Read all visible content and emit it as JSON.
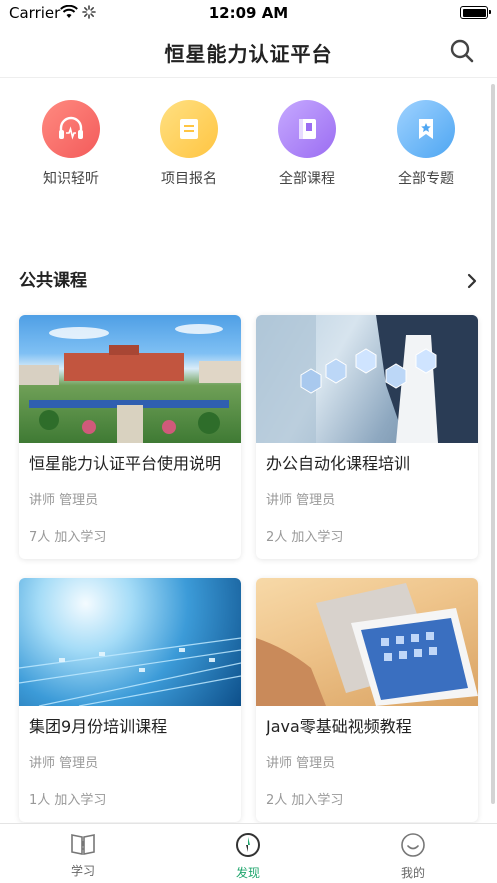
{
  "status_bar": {
    "carrier": "Carrier",
    "time": "12:09 AM"
  },
  "nav": {
    "title": "恒星能力认证平台"
  },
  "shortcuts": [
    {
      "label": "知识轻听",
      "icon": "headphones-icon",
      "color": "#f35b5b"
    },
    {
      "label": "项目报名",
      "icon": "form-icon",
      "color": "#ffc542"
    },
    {
      "label": "全部课程",
      "icon": "book-icon",
      "color": "#9b6df2"
    },
    {
      "label": "全部专题",
      "icon": "bookmark-star-icon",
      "color": "#4ea6f2"
    }
  ],
  "section": {
    "title": "公共课程"
  },
  "courses": [
    {
      "title": "恒星能力认证平台使用说明",
      "teacher": "讲师 管理员",
      "joined": "7人 加入学习"
    },
    {
      "title": "办公自动化课程培训",
      "teacher": "讲师 管理员",
      "joined": "2人 加入学习"
    },
    {
      "title": "集团9月份培训课程",
      "teacher": "讲师 管理员",
      "joined": "1人 加入学习"
    },
    {
      "title": "Java零基础视频教程",
      "teacher": "讲师 管理员",
      "joined": "2人 加入学习"
    }
  ],
  "tabs": [
    {
      "label": "学习",
      "icon": "book-open-icon"
    },
    {
      "label": "发现",
      "icon": "compass-icon",
      "active": true
    },
    {
      "label": "我的",
      "icon": "smiley-icon"
    }
  ],
  "colors": {
    "accent": "#1fa66d"
  }
}
